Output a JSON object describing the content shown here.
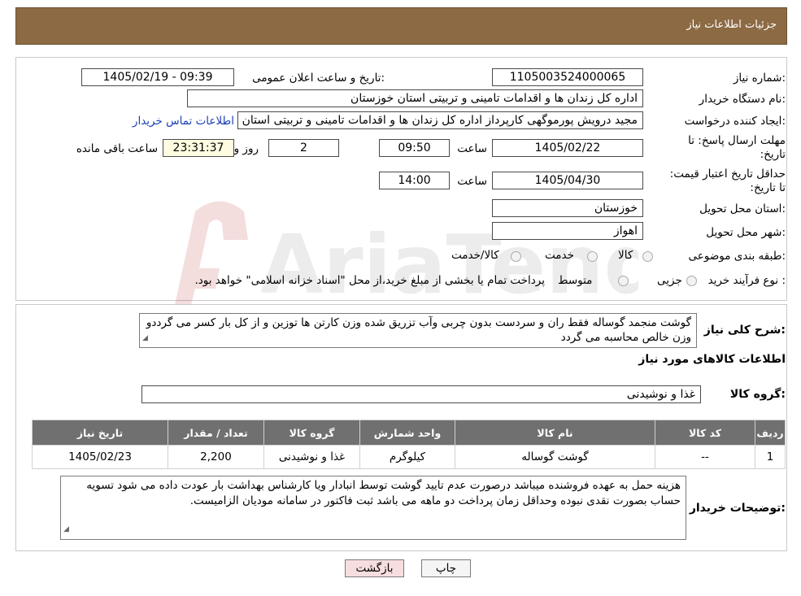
{
  "header": {
    "title": "جزئیات اطلاعات نیاز"
  },
  "form": {
    "need_number_label": "شماره نیاز:",
    "need_number": "1105003524000065",
    "announce_label": "تاریخ و ساعت اعلان عمومی:",
    "announce_value": "1405/02/19 - 09:39",
    "buyer_label": "نام دستگاه خریدار:",
    "buyer_value": "اداره کل زندان ها و اقدامات تامینی و تربیتی استان خوزستان",
    "creator_label": "ایجاد کننده درخواست:",
    "creator_value": "مجید درویش پورموگهی کارپرداز اداره کل زندان ها و اقدامات تامینی و تربیتی استان",
    "contact_link": "اطلاعات تماس خریدار",
    "deadline_label": "مهلت ارسال پاسخ: تا تاریخ:",
    "deadline_date": "1405/02/22",
    "time_label": "ساعت",
    "deadline_time": "09:50",
    "days_value": "2",
    "days_label": "روز و",
    "remaining_value": "23:31:37",
    "remaining_label": "ساعت باقی مانده",
    "validity_label": "حداقل تاریخ اعتبار قیمت: تا تاریخ:",
    "validity_date": "1405/04/30",
    "validity_time": "14:00",
    "province_label": "استان محل تحویل:",
    "province_value": "خوزستان",
    "city_label": "شهر محل تحویل:",
    "city_value": "اهواز",
    "category_label": "طبقه بندی موضوعی:",
    "category_options": [
      "کالا",
      "خدمت",
      "کالا/خدمت"
    ],
    "process_label": "نوع فرآیند خرید :",
    "process_options": [
      "جزیی",
      "متوسط"
    ],
    "process_note": "پرداخت تمام یا بخشی از مبلغ خرید،از محل \"اسناد خزانه اسلامی\" خواهد بود."
  },
  "summary": {
    "label": "شرح کلی نیاز:",
    "text": "گوشت منجمد گوساله فقط ران و سردست بدون چربی وآب تزریق شده وزن کارتن ها توزین و از کل بار کسر می گرددو وزن خالص محاسبه می گردد"
  },
  "goods_info": {
    "title": "اطلاعات کالاهای مورد نیاز",
    "group_label": "گروه کالا:",
    "group_value": "غذا و نوشیدنی"
  },
  "table": {
    "headers": [
      "ردیف",
      "کد کالا",
      "نام کالا",
      "واحد شمارش",
      "گروه کالا",
      "تعداد / مقدار",
      "تاریخ نیاز"
    ],
    "rows": [
      [
        "1",
        "--",
        "گوشت گوساله",
        "کیلوگرم",
        "غذا و نوشیدنی",
        "2,200",
        "1405/02/23"
      ]
    ]
  },
  "buyer_notes": {
    "label": "توضیحات خریدار:",
    "text": "هزینه حمل به عهده فروشنده میباشد درصورت عدم تایید گوشت توسط انبادار ویا کارشناس بهداشت بار عودت داده می شود تسویه حساب بصورت نقدی نبوده وحداقل زمان پرداخت دو ماهه می باشد ثبت فاکتور  در سامانه مودیان الزامیست."
  },
  "buttons": {
    "print": "چاپ",
    "back": "بازگشت"
  },
  "watermark": "AriaTender.neT",
  "colors": {
    "header_bg": "#8c6a44",
    "table_header_bg": "#707070",
    "link": "#1a3fb5",
    "remaining_bg": "#fdfce0",
    "back_btn_bg": "#f7dede"
  }
}
